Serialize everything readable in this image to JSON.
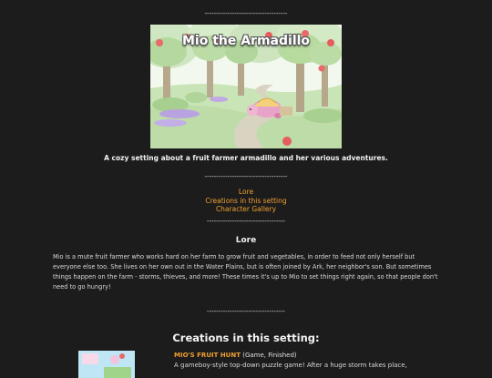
{
  "divider": "------------------------------------",
  "divider_short": "----------------------------------",
  "banner": {
    "title": "Mio the Armadillo"
  },
  "tagline": "A cozy setting about a fruit farmer armadillo and her various adventures.",
  "nav": {
    "items": [
      {
        "label": "Lore"
      },
      {
        "label": "Creations in this setting"
      },
      {
        "label": "Character Gallery"
      }
    ]
  },
  "lore": {
    "heading": "Lore",
    "text": "Mio is a mute fruit farmer who works hard on her farm to grow fruit and vegetables, in order to feed not only herself but everyone else too. She lives on her own out in the Water Plains, but is often joined by Ark, her neighbor's son. But sometimes things happen on the farm - storms, thieves, and more! These times it's up to Mio to set things right again, so that people don't need to go hungry!"
  },
  "creations": {
    "heading": "Creations in this setting:",
    "items": [
      {
        "name": "MIO'S FRUIT HUNT",
        "meta": " (Game, Finished)",
        "description": "A gameboy-style top-down puzzle game! After a huge storm takes place,"
      }
    ]
  },
  "colors": {
    "background": "#1c1c1c",
    "link": "#f0a030",
    "text": "#e0e0e0"
  }
}
